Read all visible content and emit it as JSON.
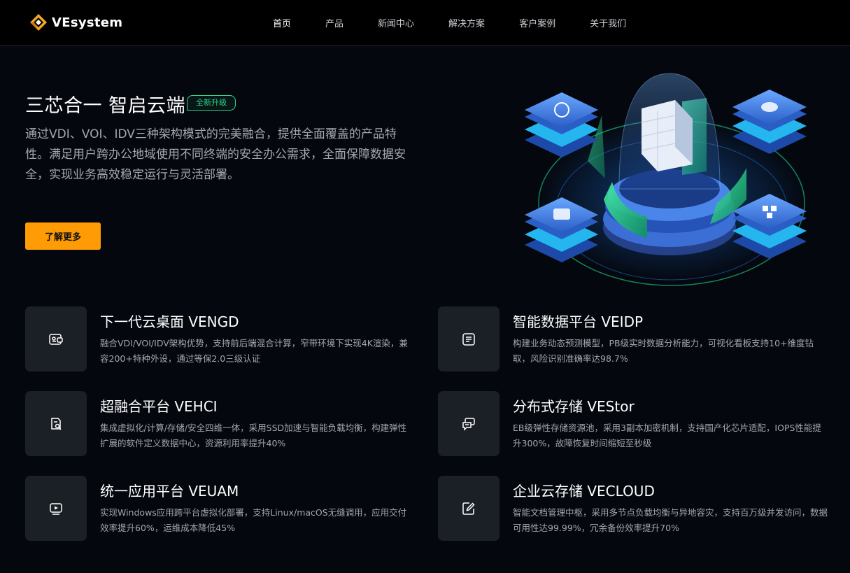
{
  "header": {
    "logo_text": "VEsystem",
    "nav": [
      {
        "label": "首页",
        "active": true
      },
      {
        "label": "产品"
      },
      {
        "label": "新闻中心"
      },
      {
        "label": "解决方案"
      },
      {
        "label": "客户案例"
      },
      {
        "label": "关于我们"
      }
    ]
  },
  "hero": {
    "title": "三芯合一 智启云端",
    "badge": "全新升级",
    "description": "通过VDI、VOI、IDV三种架构模式的完美融合，提供全面覆盖的产品特性。满足用户跨办公地域使用不同终端的安全办公需求，全面保障数据安全，实现业务高效稳定运行与灵活部署。",
    "button_label": "了解更多"
  },
  "cards": [
    {
      "icon": "desktop-card-icon",
      "title": "下一代云桌面 VENGD",
      "desc": "融合VDI/VOI/IDV架构优势，支持前后端混合计算，窄带环境下实现4K渲染，兼容200+特种外设，通过等保2.0三级认证"
    },
    {
      "icon": "data-list-icon",
      "title": "智能数据平台 VEIDP",
      "desc": "构建业务动态预测模型，PB级实时数据分析能力，可视化看板支持10+维度钻取，风险识别准确率达98.7%"
    },
    {
      "icon": "doc-search-icon",
      "title": "超融合平台 VEHCI",
      "desc": "集成虚拟化/计算/存储/安全四维一体，采用SSD加速与智能负载均衡，构建弹性扩展的软件定义数据中心，资源利用率提升40%"
    },
    {
      "icon": "chat-bubbles-icon",
      "title": "分布式存储 VEStor",
      "desc": "EB级弹性存储资源池，采用3副本加密机制，支持国产化芯片适配，IOPS性能提升300%，故障恢复时间缩短至秒级"
    },
    {
      "icon": "video-play-icon",
      "title": "统一应用平台 VEUAM",
      "desc": "实现Windows应用跨平台虚拟化部署，支持Linux/macOS无缝调用，应用交付效率提升60%，运维成本降低45%"
    },
    {
      "icon": "edit-note-icon",
      "title": "企业云存储 VECLOUD",
      "desc": "智能文档管理中枢，采用多节点负载均衡与异地容灾，支持百万级并发访问，数据可用性达99.99%，冗余备份效率提升70%"
    }
  ]
}
